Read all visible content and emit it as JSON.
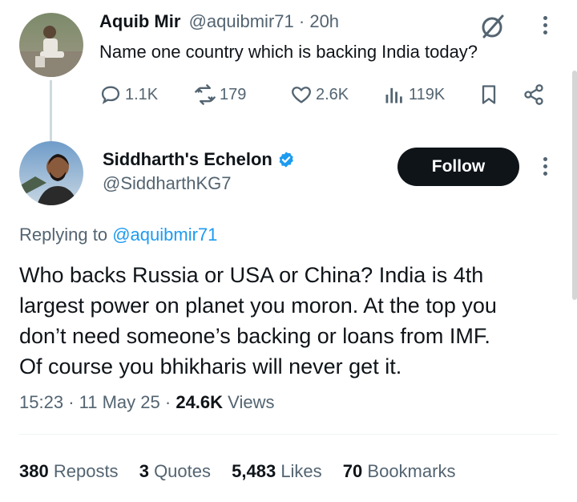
{
  "parent_tweet": {
    "display_name": "Aquib Mir",
    "handle": "@aquibmir71",
    "time_sep": "·",
    "time": "20h",
    "text": "Name one country which is backing India today?",
    "actions": {
      "replies": "1.1K",
      "reposts": "179",
      "likes": "2.6K",
      "views": "119K"
    }
  },
  "reply_tweet": {
    "display_name": "Siddharth's Echelon",
    "handle": "@SiddharthKG7",
    "follow_label": "Follow",
    "replying_prefix": "Replying to",
    "replying_handle": "@aquibmir71",
    "text_lines": [
      "Who backs Russia or USA or China? India is 4th",
      "largest power on planet you moron. At the top you",
      "don’t need someone’s backing or loans from IMF.",
      "Of course you bhikharis will never get it."
    ],
    "meta": {
      "time": "15:23",
      "sep1": "·",
      "date": "11 May 25",
      "sep2": "·",
      "views_count": "24.6K",
      "views_label": "Views"
    },
    "stats": {
      "reposts_count": "380",
      "reposts_label": "Reposts",
      "quotes_count": "3",
      "quotes_label": "Quotes",
      "likes_count": "5,483",
      "likes_label": "Likes",
      "bookmarks_count": "70",
      "bookmarks_label": "Bookmarks"
    }
  },
  "colors": {
    "text": "#0f1419",
    "secondary": "#536471",
    "link": "#1d9bf0",
    "verified": "#1d9bf0"
  }
}
